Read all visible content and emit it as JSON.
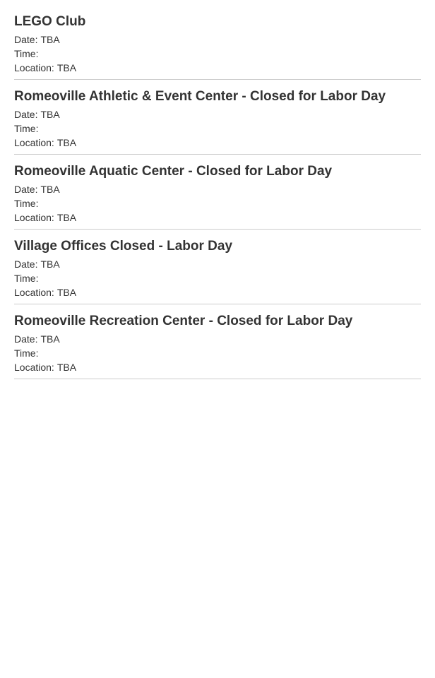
{
  "labels": {
    "date": "Date:",
    "time": "Time:",
    "location": "Location:"
  },
  "events": [
    {
      "title": "LEGO Club",
      "date": "TBA",
      "time": "",
      "location": "TBA"
    },
    {
      "title": "Romeoville Athletic & Event Center - Closed for Labor Day",
      "date": "TBA",
      "time": "",
      "location": "TBA"
    },
    {
      "title": "Romeoville Aquatic Center - Closed for Labor Day",
      "date": "TBA",
      "time": "",
      "location": "TBA"
    },
    {
      "title": "Village Offices Closed - Labor Day",
      "date": "TBA",
      "time": "",
      "location": "TBA"
    },
    {
      "title": "Romeoville Recreation Center - Closed for Labor Day",
      "date": "TBA",
      "time": "",
      "location": "TBA"
    }
  ]
}
